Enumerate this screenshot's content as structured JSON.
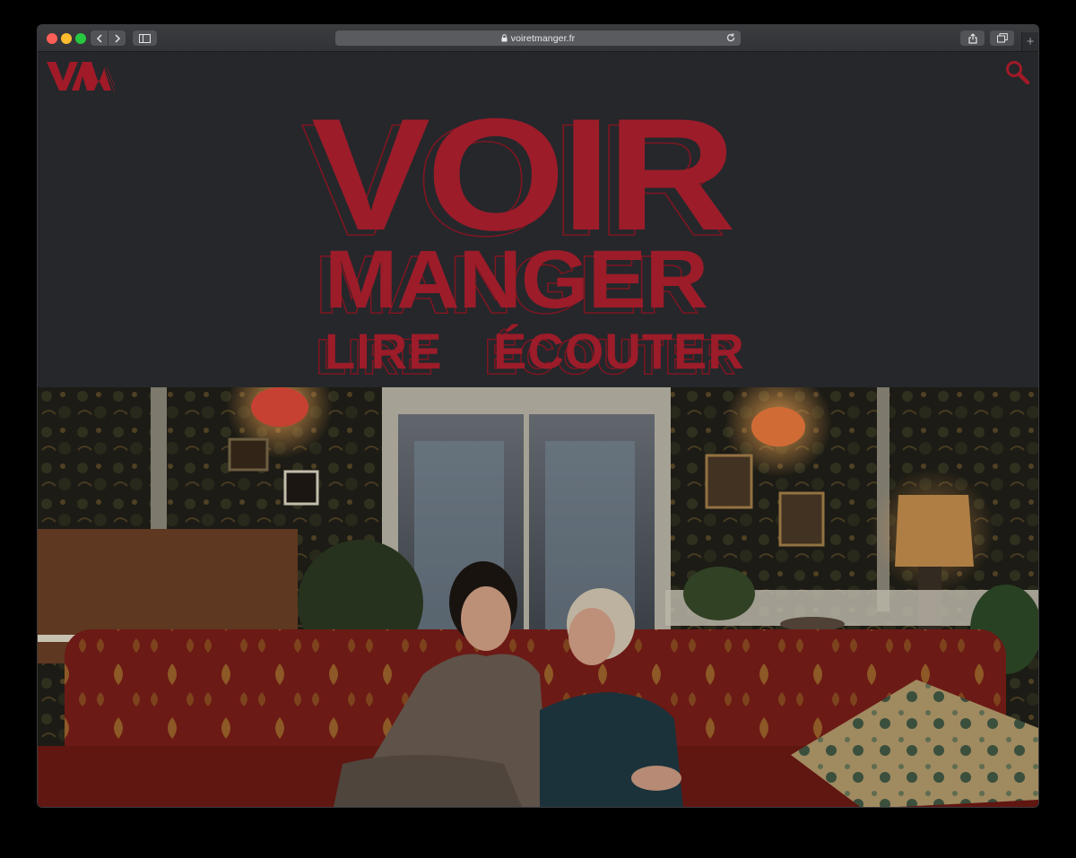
{
  "browser": {
    "url": "voiretmanger.fr",
    "new_tab": "+"
  },
  "site": {
    "hero_logo": {
      "line1": "VOIR",
      "line2": "MANGER",
      "line3_left": "LIRE",
      "line3_right": "ÉCOUTER"
    },
    "brand_color": "#9c1c29",
    "small_logo_icon": "vm-logo-icon",
    "search_icon": "search-icon"
  },
  "photo": {
    "description_icon": "featured-film-still"
  }
}
